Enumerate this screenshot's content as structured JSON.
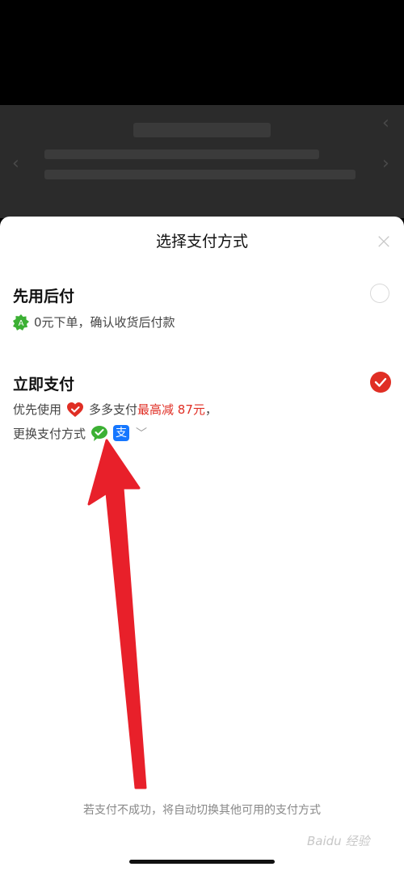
{
  "sheet": {
    "title": "选择支付方式"
  },
  "option_later": {
    "title": "先用后付",
    "desc": "0元下单，确认收货后付款",
    "selected": false
  },
  "option_now": {
    "title": "立即支付",
    "line1_prefix": "优先使用",
    "line1_brand": "多多支付",
    "line1_promo": "最高减 87元",
    "line1_suffix": "，",
    "line2": "更换支付方式",
    "selected": true
  },
  "footer": {
    "note": "若支付不成功，将自动切换其他可用的支付方式"
  },
  "watermark": {
    "text": "Baidu 经验"
  },
  "icons": {
    "close": "close-icon",
    "badge": "green-badge-icon",
    "heart": "duoduo-heart-icon",
    "wechat": "wechat-pay-icon",
    "alipay": "alipay-icon",
    "chevron": "chevron-down-icon",
    "check": "check-icon"
  },
  "colors": {
    "accent": "#e02e24",
    "green": "#3cb034",
    "alipay": "#1677ff"
  }
}
